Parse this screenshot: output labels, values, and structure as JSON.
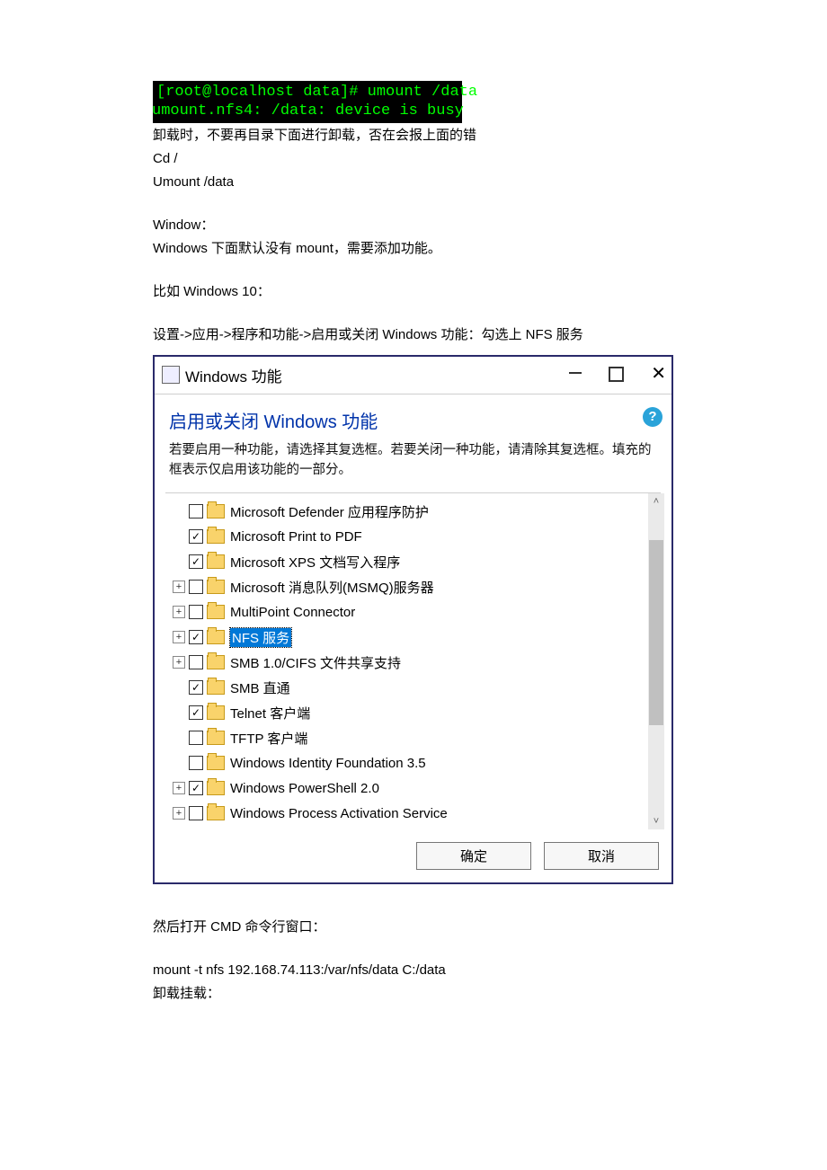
{
  "terminal": {
    "line1": "[root@localhost data]# umount /data",
    "line2": "umount.nfs4: /data: device is busy"
  },
  "doc": {
    "p1": "卸载时，不要再目录下面进行卸载，否在会报上面的错",
    "p2": "Cd /",
    "p3": "Umount /data",
    "p4": "Window：",
    "p5": "Windows 下面默认没有 mount，需要添加功能。",
    "p6": "比如 Windows 10：",
    "p7": "设置->应用->程序和功能->启用或关闭 Windows 功能：勾选上 NFS 服务",
    "p8": "然后打开 CMD 命令行窗口：",
    "p9": "mount -t nfs 192.168.74.113:/var/nfs/data C:/data",
    "p10": "卸载挂载："
  },
  "dialog": {
    "title": "Windows 功能",
    "headerTitle": "启用或关闭 Windows 功能",
    "headerDesc": "若要启用一种功能，请选择其复选框。若要关闭一种功能，请清除其复选框。填充的框表示仅启用该功能的一部分。",
    "help": "?",
    "ok": "确定",
    "cancel": "取消",
    "items": [
      {
        "label": "Microsoft Defender 应用程序防护",
        "checked": false,
        "expander": "none",
        "selected": false
      },
      {
        "label": "Microsoft Print to PDF",
        "checked": true,
        "expander": "none",
        "selected": false
      },
      {
        "label": "Microsoft XPS 文档写入程序",
        "checked": true,
        "expander": "none",
        "selected": false
      },
      {
        "label": "Microsoft 消息队列(MSMQ)服务器",
        "checked": false,
        "expander": "plus",
        "selected": false
      },
      {
        "label": "MultiPoint Connector",
        "checked": false,
        "expander": "plus",
        "selected": false
      },
      {
        "label": "NFS 服务",
        "checked": true,
        "expander": "plus",
        "selected": true
      },
      {
        "label": "SMB 1.0/CIFS 文件共享支持",
        "checked": false,
        "expander": "plus",
        "selected": false
      },
      {
        "label": "SMB 直通",
        "checked": true,
        "expander": "none",
        "selected": false
      },
      {
        "label": "Telnet 客户端",
        "checked": true,
        "expander": "none",
        "selected": false
      },
      {
        "label": "TFTP 客户端",
        "checked": false,
        "expander": "none",
        "selected": false
      },
      {
        "label": "Windows Identity Foundation 3.5",
        "checked": false,
        "expander": "none",
        "selected": false
      },
      {
        "label": "Windows PowerShell 2.0",
        "checked": true,
        "expander": "plus",
        "selected": false
      },
      {
        "label": "Windows Process Activation Service",
        "checked": false,
        "expander": "plus",
        "selected": false
      }
    ]
  }
}
